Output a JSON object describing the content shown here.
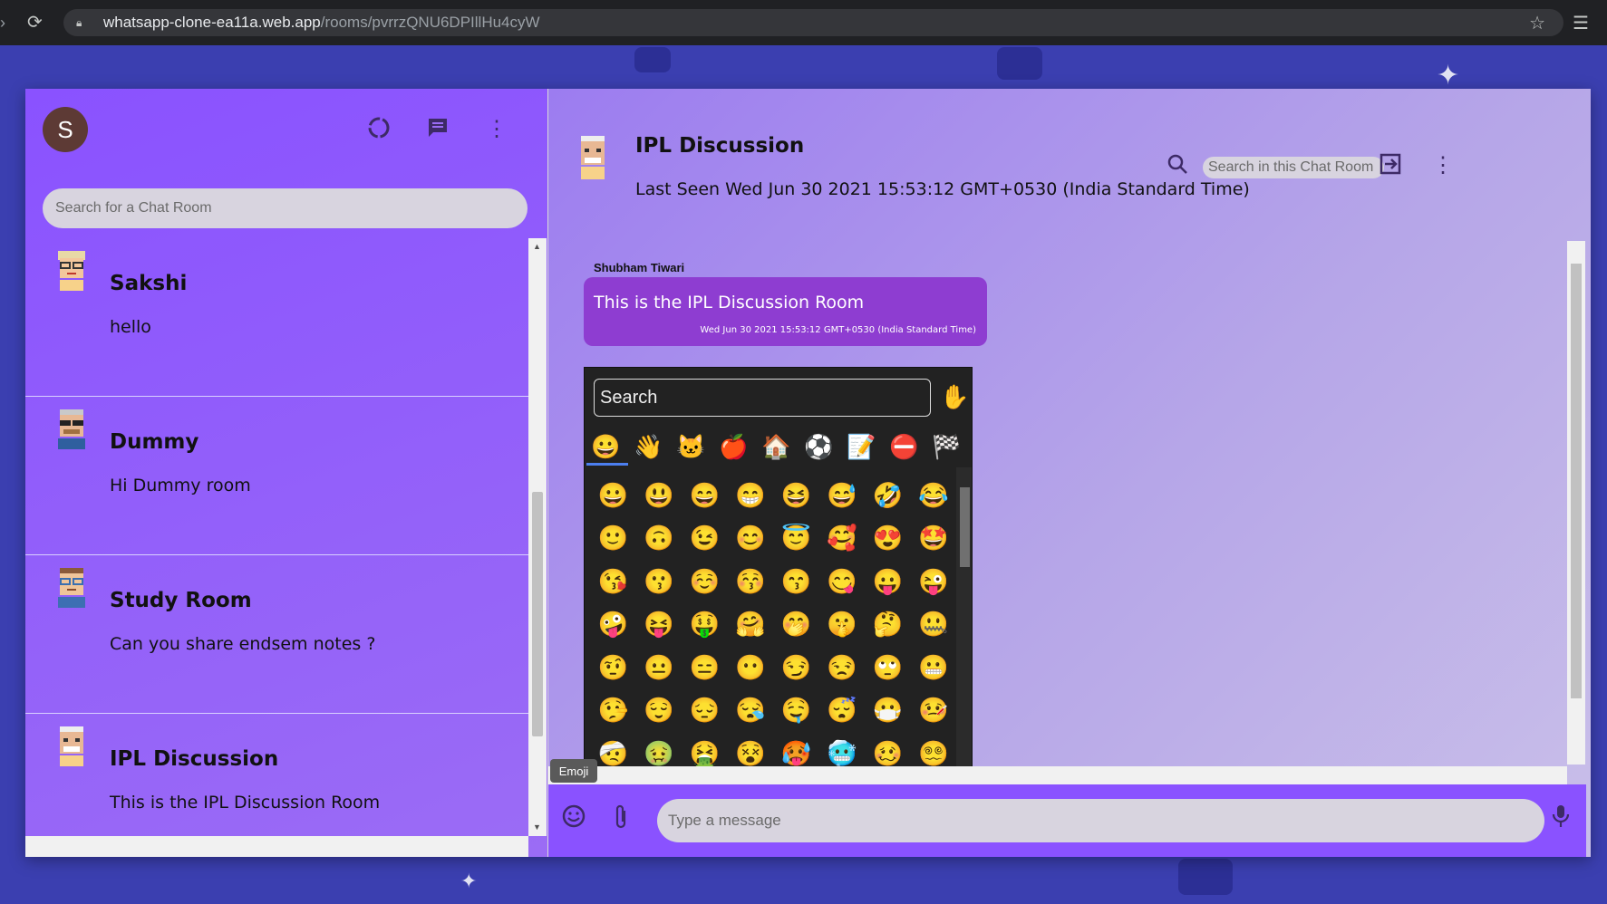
{
  "browser": {
    "url_host": "whatsapp-clone-ea11a.web.app",
    "url_path": "/rooms/pvrrzQNU6DPIllHu4cyW"
  },
  "sidebar": {
    "user_initial": "S",
    "search_placeholder": "Search for a Chat Room",
    "rooms": [
      {
        "name": "Sakshi",
        "last_message": "hello",
        "avatar": "pixel-avatar-glasses-woman"
      },
      {
        "name": "Dummy",
        "last_message": "Hi Dummy room",
        "avatar": "pixel-avatar-sunglasses-man"
      },
      {
        "name": "Study Room",
        "last_message": "Can you share endsem notes ?",
        "avatar": "pixel-avatar-glasses-boy"
      },
      {
        "name": "IPL Discussion",
        "last_message": "This is the IPL Discussion Room",
        "avatar": "pixel-avatar-bald-man"
      }
    ]
  },
  "chat": {
    "title": "IPL Discussion",
    "last_seen": "Last Seen Wed Jun 30 2021 15:53:12 GMT+0530 (India Standard Time)",
    "search_placeholder": "Search in this Chat Room",
    "messages": [
      {
        "sender": "Shubham Tiwari",
        "text": "This is the IPL Discussion Room",
        "timestamp": "Wed Jun 30 2021 15:53:12 GMT+0530 (India Standard Time)"
      }
    ],
    "emoji_tooltip": "Emoji",
    "input_placeholder": "Type a message"
  },
  "emoji_picker": {
    "search_placeholder": "Search",
    "skin_tone": "✋",
    "categories": [
      "😀",
      "👋",
      "🐱",
      "🍎",
      "🏠",
      "⚽",
      "📝",
      "⛔",
      "🏁"
    ],
    "emojis": [
      "😀",
      "😃",
      "😄",
      "😁",
      "😆",
      "😅",
      "🤣",
      "😂",
      "🙂",
      "🙃",
      "😉",
      "😊",
      "😇",
      "🥰",
      "😍",
      "🤩",
      "😘",
      "😗",
      "☺️",
      "😚",
      "😙",
      "😋",
      "😛",
      "😜",
      "🤪",
      "😝",
      "🤑",
      "🤗",
      "🤭",
      "🤫",
      "🤔",
      "🤐",
      "🤨",
      "😐",
      "😑",
      "😶",
      "😏",
      "😒",
      "🙄",
      "😬",
      "🤥",
      "😌",
      "😔",
      "😪",
      "🤤",
      "😴",
      "😷",
      "🤒",
      "🤕",
      "🤢",
      "🤮",
      "😵",
      "🥵",
      "🥶",
      "🥴",
      "😵‍💫"
    ]
  },
  "colors": {
    "accent": "#8a52ff",
    "bubble": "#8e3dd1",
    "icon": "#3d2a66"
  }
}
